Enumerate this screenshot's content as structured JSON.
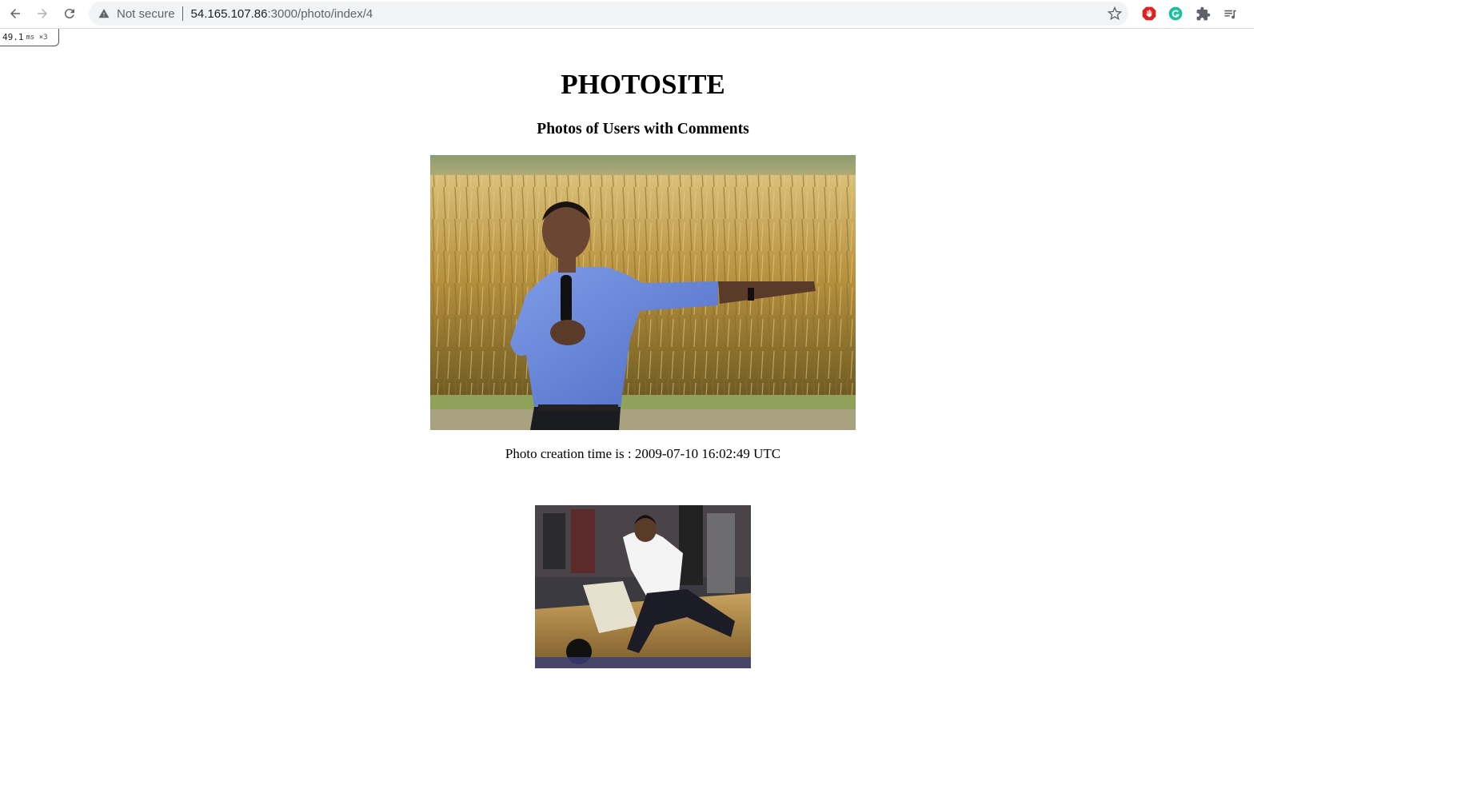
{
  "browser": {
    "security_label": "Not secure",
    "url_host": "54.165.107.86",
    "url_path": ":3000/photo/index/4",
    "icons": [
      "back-icon",
      "forward-icon",
      "reload-icon",
      "warning-icon",
      "star-icon",
      "adblock-icon",
      "grammarly-icon",
      "extensions-icon",
      "reading-list-icon",
      "profile-avatar"
    ]
  },
  "timer_badge": {
    "value": "49.1",
    "unit": "ms ×3"
  },
  "page": {
    "title": "PHOTOSITE",
    "subtitle": "Photos of Users with Comments",
    "photos": [
      {
        "caption": "Photo creation time is : 2009-07-10 16:02:49 UTC"
      }
    ]
  }
}
